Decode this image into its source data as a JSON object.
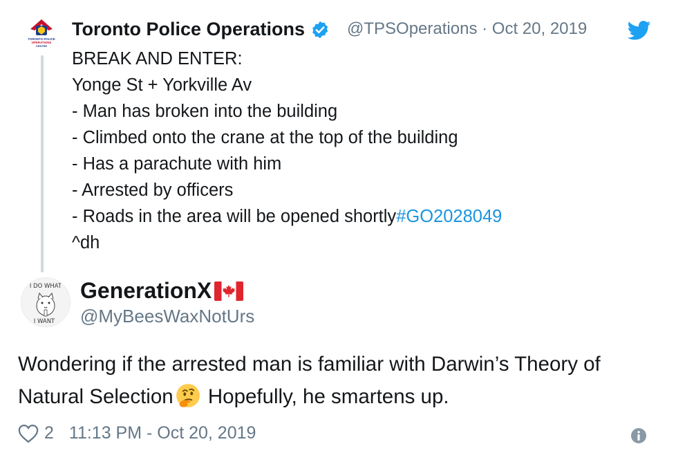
{
  "parent_tweet": {
    "author_name": "Toronto Police Operations",
    "avatar_label_lines": [
      "TORONTO POLICE",
      "OPERATIONS",
      "CENTRE"
    ],
    "handle": "@TPSOperations",
    "separator": "·",
    "date": "Oct 20, 2019",
    "lines": [
      "BREAK AND ENTER:",
      "Yonge St + Yorkville Av",
      "- Man has broken into the building",
      "- Climbed onto the crane at the top of the building",
      "- Has a parachute with him",
      "- Arrested by officers"
    ],
    "last_line_text": "- Roads in the area will be opened shortly",
    "hashtag": "#GO2028049",
    "signature": "^dh"
  },
  "reply_tweet": {
    "author_name": "GenerationX",
    "avatar_text_top": "I DO WHAT",
    "avatar_text_bottom": "I WANT",
    "handle": "@MyBeesWaxNotUrs",
    "text_part1": "Wondering if the arrested man is familiar with Darwin’s Theory of Natural Selection",
    "emoji": "thinking-face",
    "text_part2": " Hopefully, he smartens up.",
    "likes": "2",
    "timestamp": "11:13 PM - Oct 20, 2019"
  },
  "icons": {
    "verified": "verified-badge-icon",
    "platform": "twitter-bird-icon",
    "like": "heart-icon",
    "info": "info-icon",
    "flag": "canada-flag-icon"
  },
  "colors": {
    "accent": "#1da1f2",
    "link": "#1b95e0",
    "secondary_text": "#657786",
    "flag_red": "#e0252f"
  }
}
